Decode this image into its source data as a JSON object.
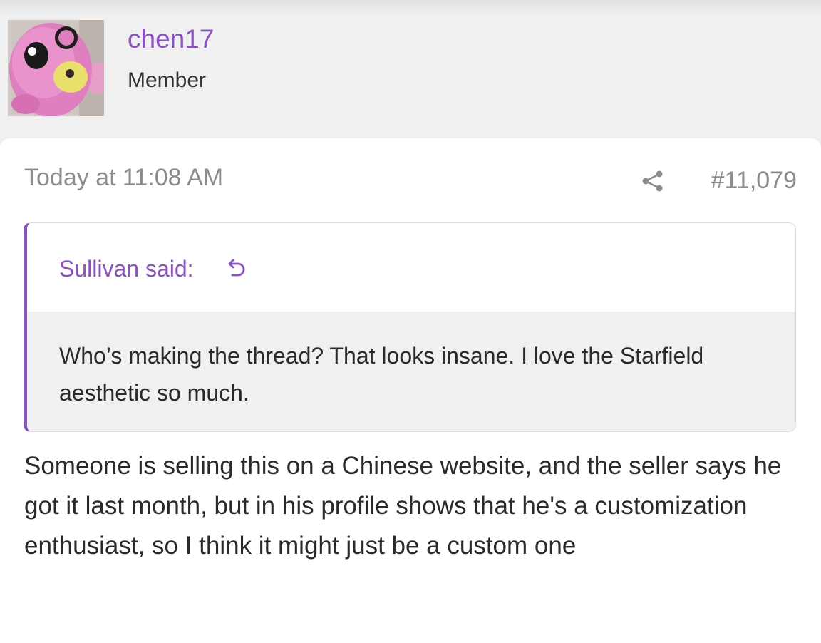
{
  "user": {
    "name": "chen17",
    "title": "Member"
  },
  "post": {
    "date": "Today at 11:08 AM",
    "number": "#11,079",
    "body": "Someone is selling this on a Chinese website, and the seller says he got it last month, but in his profile shows that he's a customization enthusiast, so I think it might just be a custom one"
  },
  "quote": {
    "author": "Sullivan said:",
    "text": "Who’s making the thread? That looks insane. I love the Starfield aesthetic so much."
  },
  "icons": {
    "share": "share-icon",
    "quote_jump": "quote-jump-icon"
  },
  "colors": {
    "accent": "#8a50c8",
    "muted_text": "#8c8c8c",
    "body_text": "#2a2a2a",
    "header_bg": "#f0f0f0",
    "quote_body_bg": "#f0f0f0"
  }
}
